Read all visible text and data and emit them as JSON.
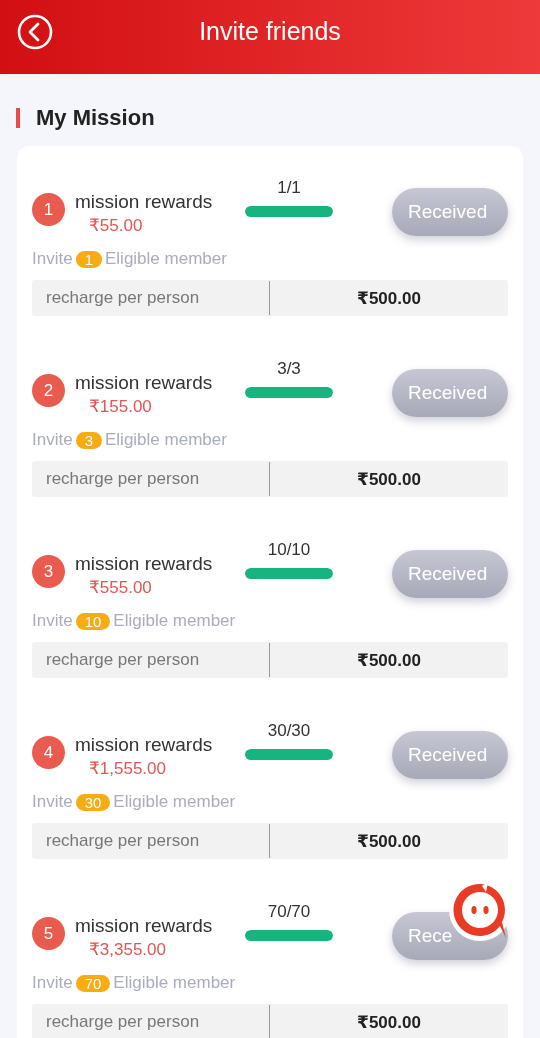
{
  "header": {
    "title": "Invite friends"
  },
  "section": {
    "title": "My Mission"
  },
  "missions": [
    {
      "number": "1",
      "title": "mission rewards",
      "reward": "₹55.00",
      "progress": "1/1",
      "level": 1,
      "button": "Received",
      "claimed": true,
      "invite_prefix": "Invite",
      "invite_count": "1",
      "invite_suffix": "Eligible member",
      "row_label": "recharge per person",
      "row_value": "₹500.00"
    },
    {
      "number": "2",
      "title": "mission rewards",
      "reward": "₹155.00",
      "progress": "3/3",
      "level": 1,
      "button": "Received",
      "claimed": true,
      "invite_prefix": "Invite",
      "invite_count": "3",
      "invite_suffix": "Eligible member",
      "row_label": "recharge per person",
      "row_value": "₹500.00"
    },
    {
      "number": "3",
      "title": "mission rewards",
      "reward": "₹555.00",
      "progress": "10/10",
      "level": 1,
      "button": "Received",
      "claimed": true,
      "invite_prefix": "Invite",
      "invite_count": "10",
      "invite_suffix": "Eligible member",
      "row_label": "recharge per person",
      "row_value": "₹500.00"
    },
    {
      "number": "4",
      "title": "mission rewards",
      "reward": "₹1,555.00",
      "progress": "30/30",
      "level": 1,
      "button": "Received",
      "claimed": true,
      "invite_prefix": "Invite",
      "invite_count": "30",
      "invite_suffix": "Eligible member",
      "row_label": "recharge per person",
      "row_value": "₹500.00"
    },
    {
      "number": "5",
      "title": "mission rewards",
      "reward": "₹3,355.00",
      "progress": "70/70",
      "level": 1,
      "button": "Rece",
      "claimed": true,
      "invite_prefix": "Invite",
      "invite_count": "70",
      "invite_suffix": "Eligible member",
      "row_label": "recharge per person",
      "row_value": "₹500.00"
    }
  ]
}
